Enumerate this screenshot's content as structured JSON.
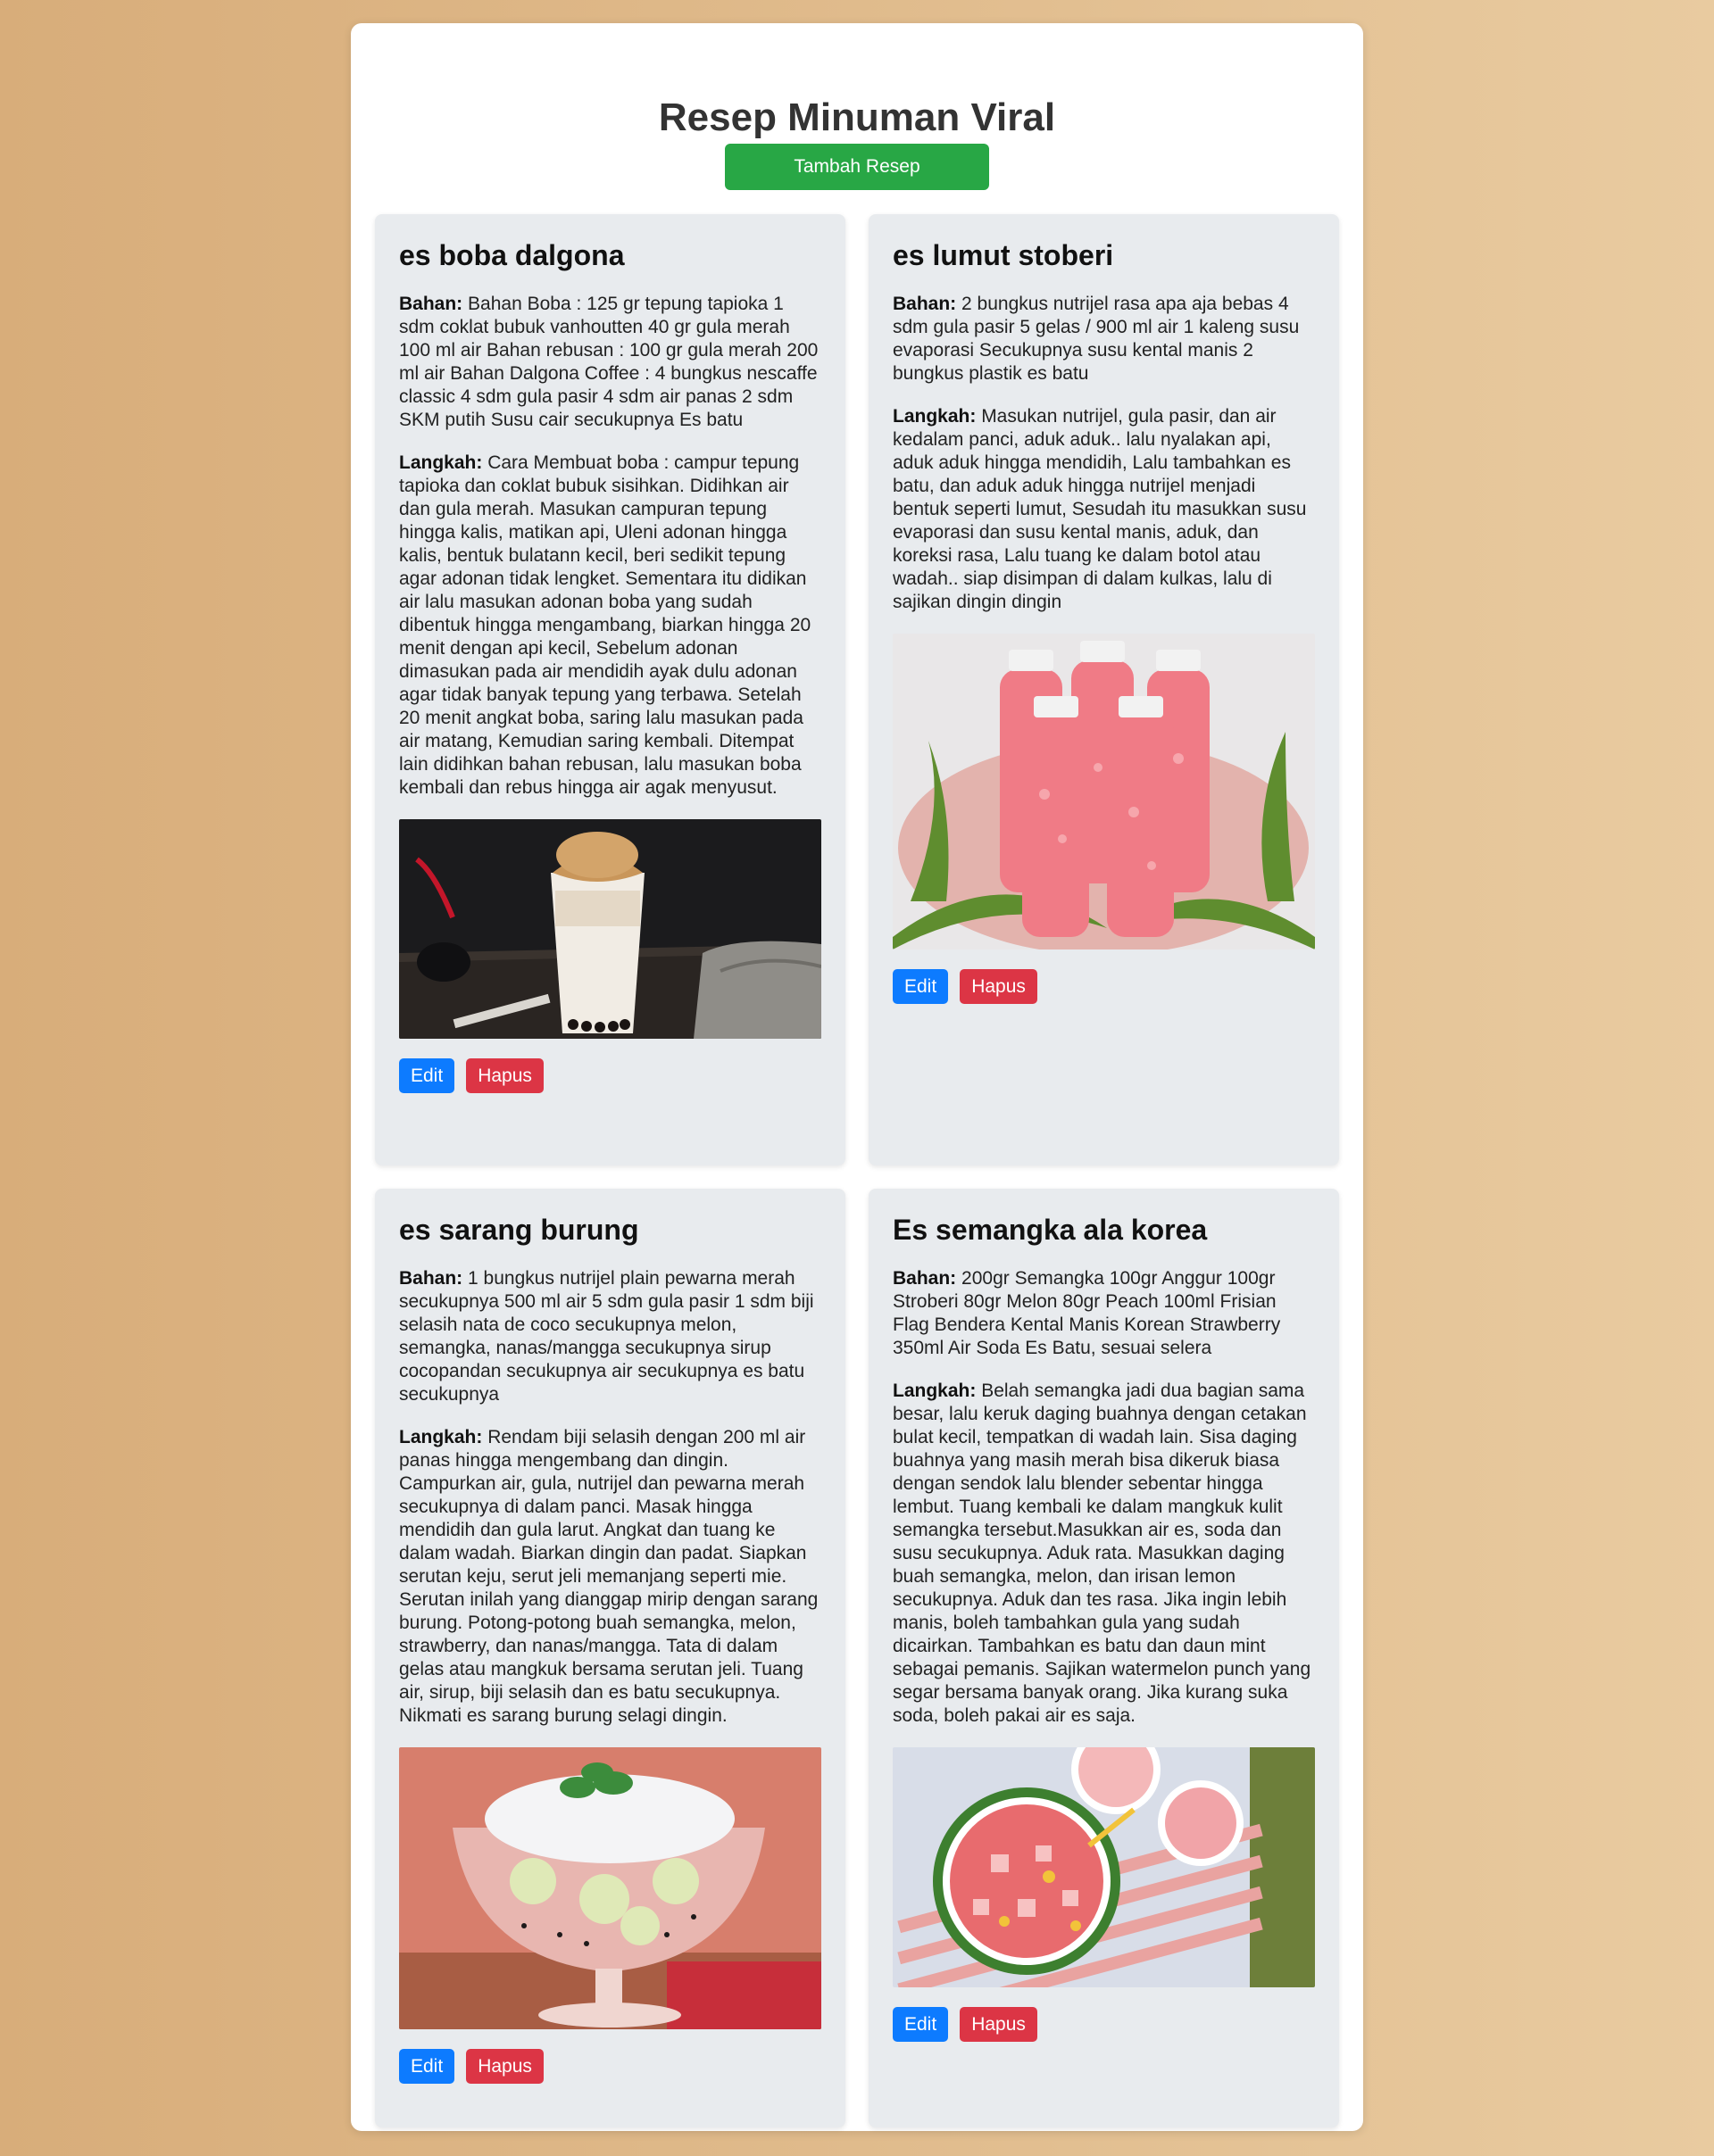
{
  "page": {
    "title": "Resep Minuman Viral",
    "add_button": "Tambah Resep"
  },
  "labels": {
    "ingredients": "Bahan:",
    "steps": "Langkah:",
    "edit": "Edit",
    "delete": "Hapus"
  },
  "colors": {
    "add_button": "#28a745",
    "edit_button": "#0d7bff",
    "delete_button": "#dc3545",
    "card_background": "#e8ebee"
  },
  "recipes": [
    {
      "name": "es boba dalgona",
      "ingredients": "Bahan Boba : 125 gr tepung tapioka 1 sdm coklat bubuk vanhoutten 40 gr gula merah 100 ml air Bahan rebusan : 100 gr gula merah 200 ml air Bahan Dalgona Coffee : 4 bungkus nescaffe classic 4 sdm gula pasir 4 sdm air panas 2 sdm SKM putih Susu cair secukupnya Es batu",
      "steps": "Cara Membuat boba : campur tepung tapioka dan coklat bubuk sisihkan. Didihkan air dan gula merah. Masukan campuran tepung hingga kalis, matikan api, Uleni adonan hingga kalis, bentuk bulatann kecil, beri sedikit tepung agar adonan tidak lengket. Sementara itu didikan air lalu masukan adonan boba yang sudah dibentuk hingga mengambang, biarkan hingga 20 menit dengan api kecil, Sebelum adonan dimasukan pada air mendidih ayak dulu adonan agar tidak banyak tepung yang terbawa. Setelah 20 menit angkat boba, saring lalu masukan pada air matang, Kemudian saring kembali. Ditempat lain didihkan bahan rebusan, lalu masukan boba kembali dan rebus hingga air agak menyusut.",
      "image": "dalgona-boba-photo"
    },
    {
      "name": "es lumut stoberi",
      "ingredients": "2 bungkus nutrijel rasa apa aja bebas 4 sdm gula pasir 5 gelas / 900 ml air 1 kaleng susu evaporasi Secukupnya susu kental manis 2 bungkus plastik es batu",
      "steps": "Masukan nutrijel, gula pasir, dan air kedalam panci, aduk aduk.. lalu nyalakan api, aduk aduk hingga mendidih, Lalu tambahkan es batu, dan aduk aduk hingga nutrijel menjadi bentuk seperti lumut, Sesudah itu masukkan susu evaporasi dan susu kental manis, aduk, dan koreksi rasa, Lalu tuang ke dalam botol atau wadah.. siap disimpan di dalam kulkas, lalu di sajikan dingin dingin",
      "image": "strawberry-bottles-photo"
    },
    {
      "name": "es sarang burung",
      "ingredients": "1 bungkus nutrijel plain pewarna merah secukupnya 500 ml air 5 sdm gula pasir 1 sdm biji selasih nata de coco secukupnya melon, semangka, nanas/mangga secukupnya sirup cocopandan secukupnya air secukupnya es batu secukupnya",
      "steps": "Rendam biji selasih dengan 200 ml air panas hingga mengembang dan dingin. Campurkan air, gula, nutrijel dan pewarna merah secukupnya di dalam panci. Masak hingga mendidih dan gula larut. Angkat dan tuang ke dalam wadah. Biarkan dingin dan padat. Siapkan serutan keju, serut jeli memanjang seperti mie. Serutan inilah yang dianggap mirip dengan sarang burung. Potong-potong buah semangka, melon, strawberry, dan nanas/mangga. Tata di dalam gelas atau mangkuk bersama serutan jeli. Tuang air, sirup, biji selasih dan es batu secukupnya. Nikmati es sarang burung selagi dingin.",
      "image": "bird-nest-dessert-photo"
    },
    {
      "name": "Es semangka ala korea",
      "ingredients": "200gr Semangka 100gr Anggur 100gr Stroberi 80gr Melon 80gr Peach 100ml Frisian Flag Bendera Kental Manis Korean Strawberry 350ml Air Soda Es Batu, sesuai selera",
      "steps": "Belah semangka jadi dua bagian sama besar, lalu keruk daging buahnya dengan cetakan bulat kecil, tempatkan di wadah lain. Sisa daging buahnya yang masih merah bisa dikeruk biasa dengan sendok lalu blender sebentar hingga lembut. Tuang kembali ke dalam mangkuk kulit semangka tersebut.Masukkan air es, soda dan susu secukupnya. Aduk rata. Masukkan daging buah semangka, melon, dan irisan lemon secukupnya. Aduk dan tes rasa. Jika ingin lebih manis, boleh tambahkan gula yang sudah dicairkan. Tambahkan es batu dan daun mint sebagai pemanis. Sajikan watermelon punch yang segar bersama banyak orang. Jika kurang suka soda, boleh pakai air es saja.",
      "image": "watermelon-punch-photo"
    }
  ]
}
